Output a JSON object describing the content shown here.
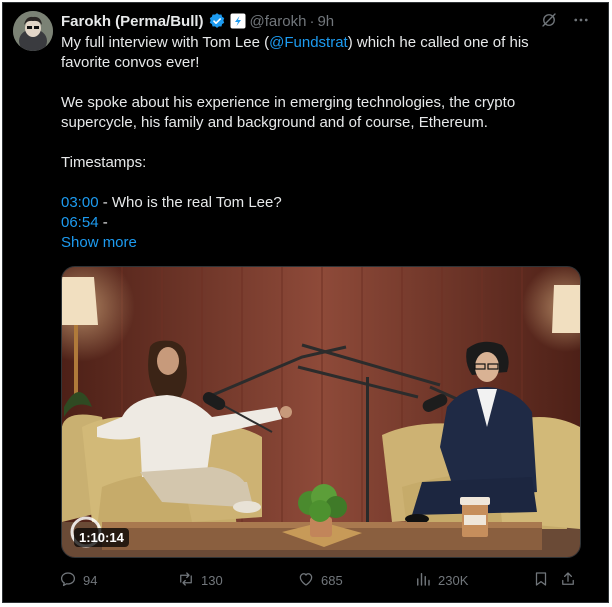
{
  "tweet": {
    "author_name": "Farokh (Perma/Bull)",
    "handle": "@farokh",
    "separator": "·",
    "time": "9h",
    "text": {
      "line1_pre": "My full interview with Tom Lee (",
      "mention": "@Fundstrat",
      "line1_post": ") which he called one of his favorite convos ever!",
      "para2": "We spoke about his experience in emerging technologies, the crypto supercycle, his family and background and of course, Ethereum.",
      "para3": "Timestamps:",
      "ts1": "03:00",
      "ts1_label": " - Who is the real Tom Lee?",
      "ts2": "06:54",
      "ts2_label": " -",
      "show_more": "Show more"
    },
    "media": {
      "duration": "1:10:14"
    },
    "actions": {
      "replies": "94",
      "reposts": "130",
      "likes": "685",
      "views": "230K"
    }
  },
  "colors": {
    "background": "#000000",
    "text": "#e7e9ea",
    "muted": "#71767b",
    "link": "#1d9bf0",
    "verified": "#1d9bf0"
  },
  "icons": [
    "verified-badge-icon",
    "affiliate-badge-icon",
    "grok-icon",
    "more-icon",
    "reply-icon",
    "repost-icon",
    "like-icon",
    "views-icon",
    "bookmark-icon",
    "share-icon"
  ]
}
